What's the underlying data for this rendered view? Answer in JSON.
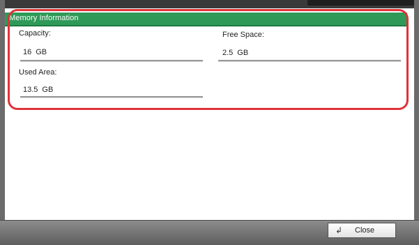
{
  "header": {
    "title": "Memory Information"
  },
  "fields": {
    "capacity": {
      "label": "Capacity:",
      "value": "16",
      "unit": "GB"
    },
    "free_space": {
      "label": "Free Space:",
      "value": "2.5",
      "unit": "GB"
    },
    "used_area": {
      "label": "Used Area:",
      "value": "13.5",
      "unit": "GB"
    }
  },
  "footer": {
    "close_label": "Close",
    "close_icon": "return-arrow-icon"
  },
  "colors": {
    "header_green": "#2f9a58",
    "highlight_red": "#e0323a"
  }
}
